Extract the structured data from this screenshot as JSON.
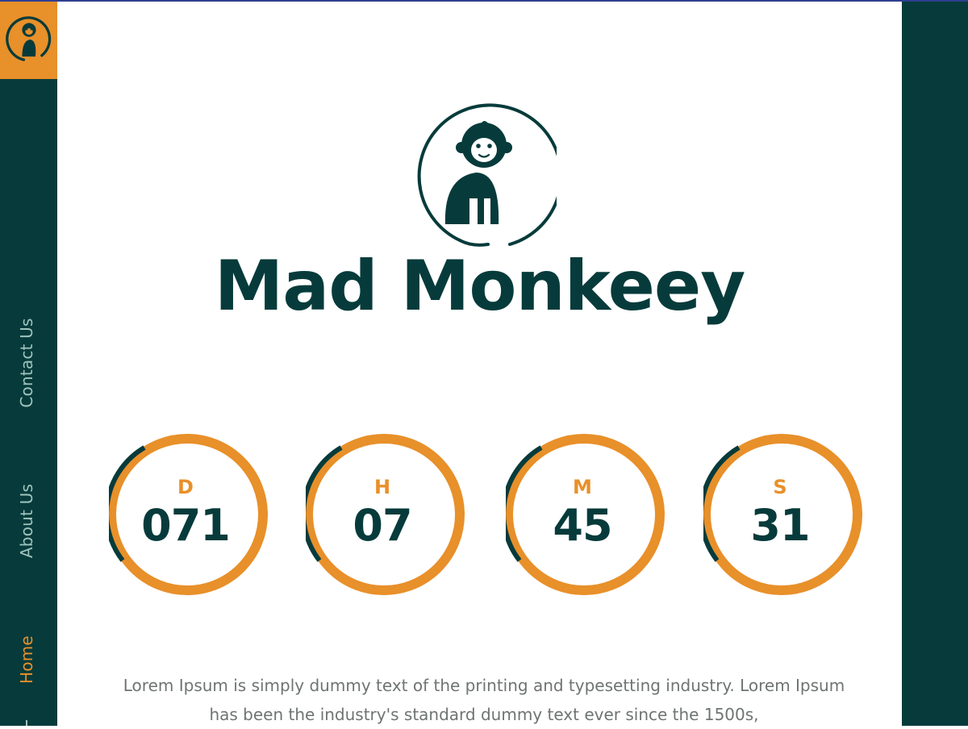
{
  "nav": {
    "items": [
      {
        "label": "Contact Us"
      },
      {
        "label": "About Us"
      },
      {
        "label": "Home"
      }
    ],
    "active": "Home"
  },
  "brand": {
    "name": "Mad Monkeey",
    "logo_icon": "monkey-logo-icon"
  },
  "countdown": [
    {
      "unit": "D",
      "value": "071"
    },
    {
      "unit": "H",
      "value": "07"
    },
    {
      "unit": "M",
      "value": "45"
    },
    {
      "unit": "S",
      "value": "31"
    }
  ],
  "description": {
    "line1": "Lorem Ipsum is simply dummy text of the printing and typesetting industry. Lorem Ipsum",
    "line2": "has been the industry's standard dummy text ever since the 1500s,"
  },
  "colors": {
    "primary": "#073b3b",
    "accent": "#e8902a",
    "text_muted": "#6e7472",
    "nav_text": "#9fc3bd"
  }
}
